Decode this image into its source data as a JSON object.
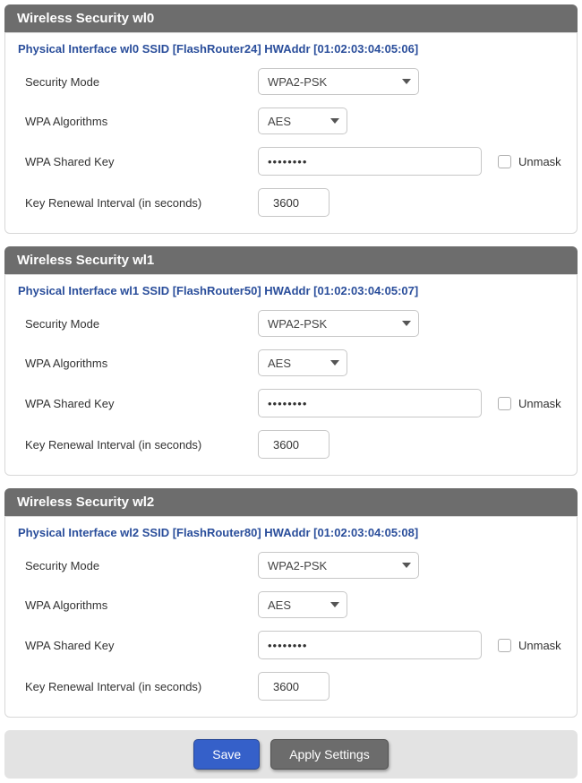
{
  "labels": {
    "security_mode": "Security Mode",
    "wpa_algorithms": "WPA Algorithms",
    "wpa_shared_key": "WPA Shared Key",
    "key_renewal": "Key Renewal Interval (in seconds)",
    "unmask": "Unmask"
  },
  "interfaces": [
    {
      "header": "Wireless Security wl0",
      "phys": "Physical Interface wl0 SSID [FlashRouter24] HWAddr [01:02:03:04:05:06]",
      "security_mode": "WPA2-PSK",
      "wpa_algorithm": "AES",
      "shared_key": "••••••••",
      "renewal": "3600"
    },
    {
      "header": "Wireless Security wl1",
      "phys": "Physical Interface wl1 SSID [FlashRouter50] HWAddr [01:02:03:04:05:07]",
      "security_mode": "WPA2-PSK",
      "wpa_algorithm": "AES",
      "shared_key": "••••••••",
      "renewal": "3600"
    },
    {
      "header": "Wireless Security wl2",
      "phys": "Physical Interface wl2 SSID [FlashRouter80] HWAddr [01:02:03:04:05:08]",
      "security_mode": "WPA2-PSK",
      "wpa_algorithm": "AES",
      "shared_key": "••••••••",
      "renewal": "3600"
    }
  ],
  "buttons": {
    "save": "Save",
    "apply": "Apply Settings"
  }
}
